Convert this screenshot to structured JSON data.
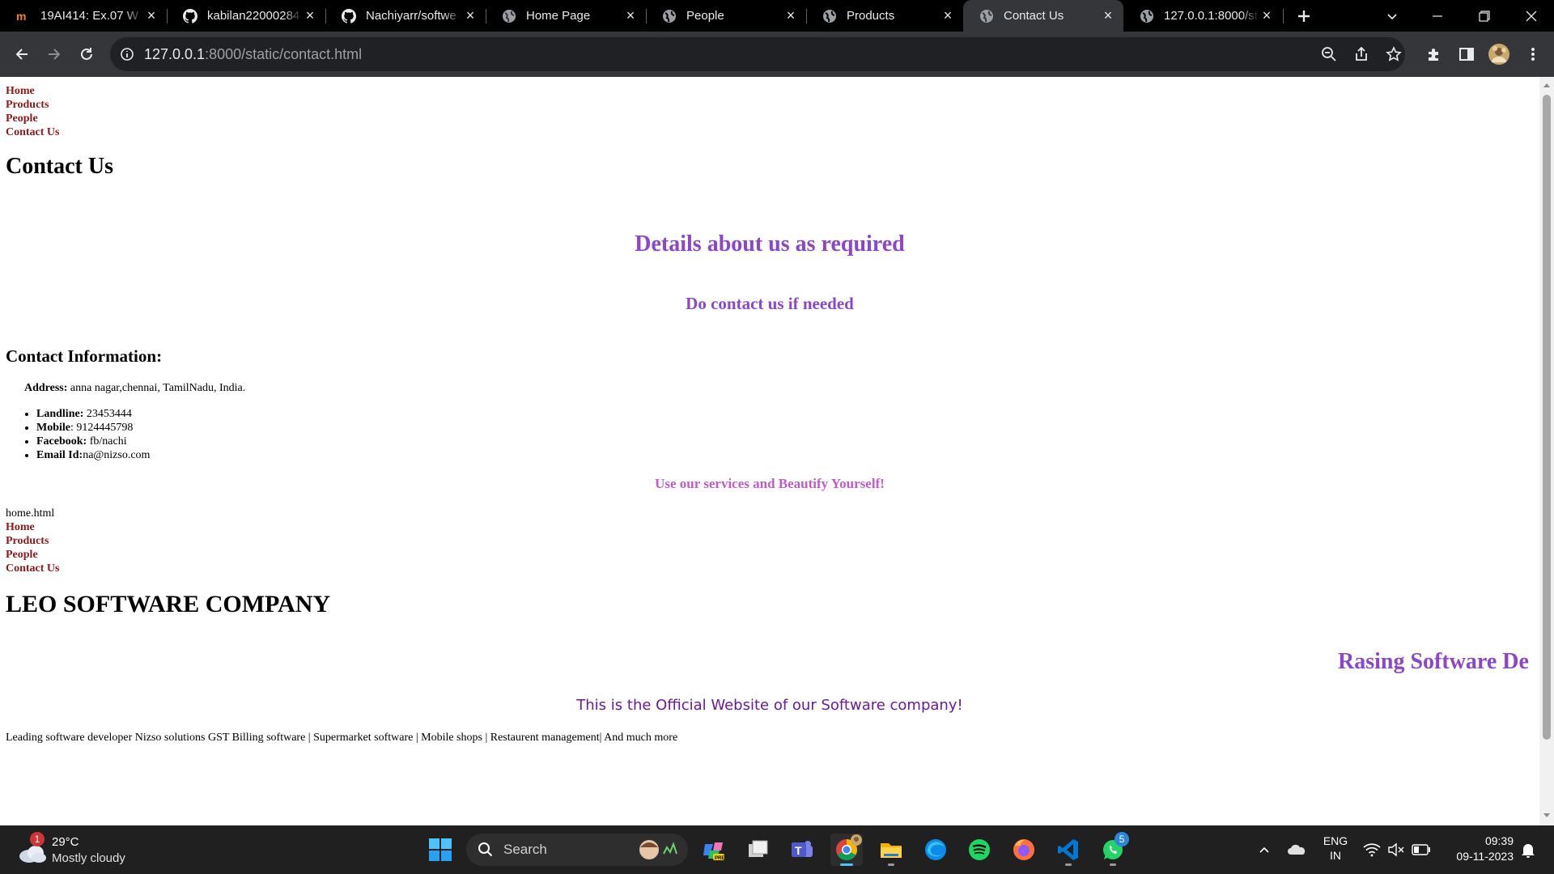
{
  "browser": {
    "tabs": [
      {
        "title": "19AI414: Ex.07 W",
        "icon": "moodle-icon"
      },
      {
        "title": "kabilan22000284",
        "icon": "github-icon"
      },
      {
        "title": "Nachiyarr/softwe",
        "icon": "github-icon"
      },
      {
        "title": "Home Page",
        "icon": "globe-icon"
      },
      {
        "title": "People",
        "icon": "globe-icon"
      },
      {
        "title": "Products",
        "icon": "globe-icon"
      },
      {
        "title": "Contact Us",
        "icon": "globe-icon",
        "active": true
      },
      {
        "title": "127.0.0.1:8000/st",
        "icon": "globe-icon"
      }
    ],
    "url_host": "127.0.0.1",
    "url_path": ":8000/static/contact.html"
  },
  "page": {
    "nav": [
      "Home",
      "Products",
      "People",
      "Contact Us"
    ],
    "title": "Contact Us",
    "details_heading": "Details about us as required",
    "contact_prompt": "Do contact us if needed",
    "contact_info_heading": "Contact Information:",
    "address_label": "Address:",
    "address_value": " anna nagar,chennai, TamilNadu, India.",
    "contacts": [
      {
        "label": "Landline:",
        "value": " 23453444"
      },
      {
        "label": "Mobile",
        "value": ": 9124445798"
      },
      {
        "label": "Facebook:",
        "value": " fb/nachi"
      },
      {
        "label": "Email Id:",
        "value": "na@nizso.com"
      }
    ],
    "tagline": "Use our services and Beautify Yourself!",
    "raw_text": "home.html",
    "nav2": [
      "Home",
      "Products",
      "People",
      "Contact Us"
    ],
    "company_name": "LEO SOFTWARE COMPANY",
    "marquee_text": "Rasing Software De",
    "official_text": "This is the Official Website of our Software company!",
    "description": "Leading software developer Nizso solutions GST Billing software | Supermarket software | Mobile shops | Restaurent management| And much more"
  },
  "taskbar": {
    "weather_temp": "29°C",
    "weather_desc": "Mostly cloudy",
    "weather_badge": "1",
    "search_label": "Search",
    "lang_top": "ENG",
    "lang_bottom": "IN",
    "time": "09:39",
    "date": "09-11-2023",
    "whatsapp_badge": "5"
  },
  "colors": {
    "heading_purple": "#8b47c8",
    "tagline_pink": "#c05bc9",
    "nav_link": "#8b1a1a",
    "official_purple": "#6a1a9a"
  }
}
